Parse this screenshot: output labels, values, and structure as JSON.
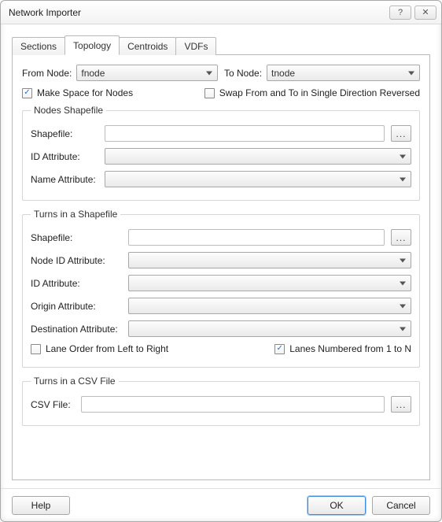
{
  "window": {
    "title": "Network Importer"
  },
  "tabs": [
    {
      "label": "Sections"
    },
    {
      "label": "Topology"
    },
    {
      "label": "Centroids"
    },
    {
      "label": "VDFs"
    }
  ],
  "activeTab": 1,
  "topology": {
    "fromNode": {
      "label": "From Node:",
      "value": "fnode"
    },
    "toNode": {
      "label": "To Node:",
      "value": "tnode"
    },
    "makeSpace": {
      "label": "Make Space for Nodes",
      "checked": true
    },
    "swapFromTo": {
      "label": "Swap From and To in Single Direction Reversed",
      "checked": false
    },
    "nodesShapefile": {
      "legend": "Nodes Shapefile",
      "shapefile": {
        "label": "Shapefile:",
        "value": ""
      },
      "idAttr": {
        "label": "ID Attribute:",
        "value": ""
      },
      "nameAttr": {
        "label": "Name Attribute:",
        "value": ""
      }
    },
    "turnsShapefile": {
      "legend": "Turns in a Shapefile",
      "shapefile": {
        "label": "Shapefile:",
        "value": ""
      },
      "nodeIdAttr": {
        "label": "Node ID Attribute:",
        "value": ""
      },
      "idAttr": {
        "label": "ID Attribute:",
        "value": ""
      },
      "originAttr": {
        "label": "Origin Attribute:",
        "value": ""
      },
      "destAttr": {
        "label": "Destination Attribute:",
        "value": ""
      },
      "laneOrder": {
        "label": "Lane Order from Left to Right",
        "checked": false
      },
      "lanesNumbered": {
        "label": "Lanes Numbered from 1 to N",
        "checked": true
      }
    },
    "turnsCsv": {
      "legend": "Turns in a CSV File",
      "csvFile": {
        "label": "CSV File:",
        "value": ""
      }
    }
  },
  "buttons": {
    "help": "Help",
    "ok": "OK",
    "cancel": "Cancel",
    "browse": "..."
  },
  "glyphs": {
    "help": "?",
    "close": "✕",
    "check": "✓"
  }
}
